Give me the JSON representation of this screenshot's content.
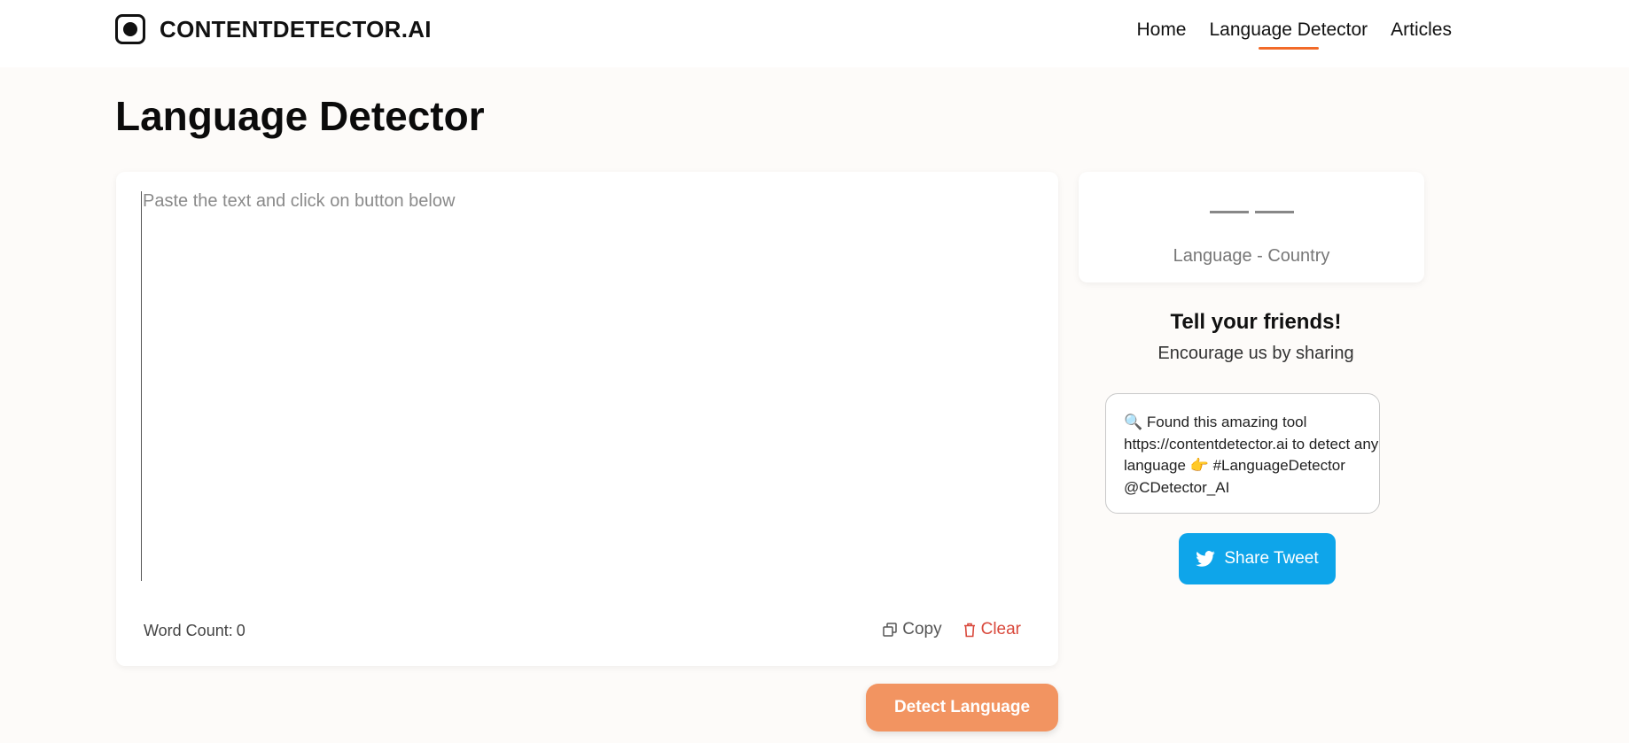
{
  "header": {
    "brand": "CONTENTDETECTOR.AI",
    "nav": [
      {
        "label": "Home",
        "active": false
      },
      {
        "label": "Language Detector",
        "active": true
      },
      {
        "label": "Articles",
        "active": false
      }
    ]
  },
  "page": {
    "title": "Language Detector"
  },
  "editor": {
    "placeholder": "Paste the text and click on button below",
    "word_count_label": "Word Count:",
    "word_count_value": "0",
    "copy_label": "Copy",
    "clear_label": "Clear",
    "detect_label": "Detect Language"
  },
  "result": {
    "label": "Language - Country"
  },
  "share": {
    "heading": "Tell your friends!",
    "subheading": "Encourage us by sharing",
    "tweet_text": "🔍 Found this amazing tool https://contentdetector.ai to detect any language 👉 #LanguageDetector @CDetector_AI",
    "tweet_button": "Share Tweet"
  },
  "colors": {
    "accent": "#f26a28",
    "detect_button": "#f29461",
    "tweet_button": "#0ea5ea",
    "clear": "#d9483b"
  },
  "icons": [
    "logo-icon",
    "copy-icon",
    "trash-icon",
    "twitter-icon"
  ]
}
